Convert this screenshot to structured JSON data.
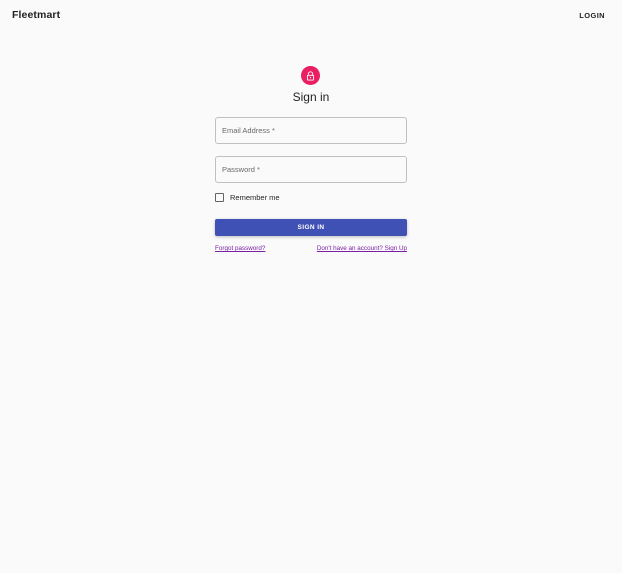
{
  "appbar": {
    "brand": "Fleetmart",
    "login_label": "LOGIN"
  },
  "form": {
    "title": "Sign in",
    "icon": "lock-icon",
    "email_label": "Email Address *",
    "password_label": "Password *",
    "remember_label": "Remember me",
    "remember_checked": false,
    "submit_label": "SIGN IN",
    "forgot_label": "Forgot password?",
    "signup_label": "Don't have an account? Sign Up"
  },
  "colors": {
    "avatar_bg": "#e91e63",
    "primary": "#3f51b5",
    "link": "#7b1fa2",
    "background": "#fafafa"
  }
}
